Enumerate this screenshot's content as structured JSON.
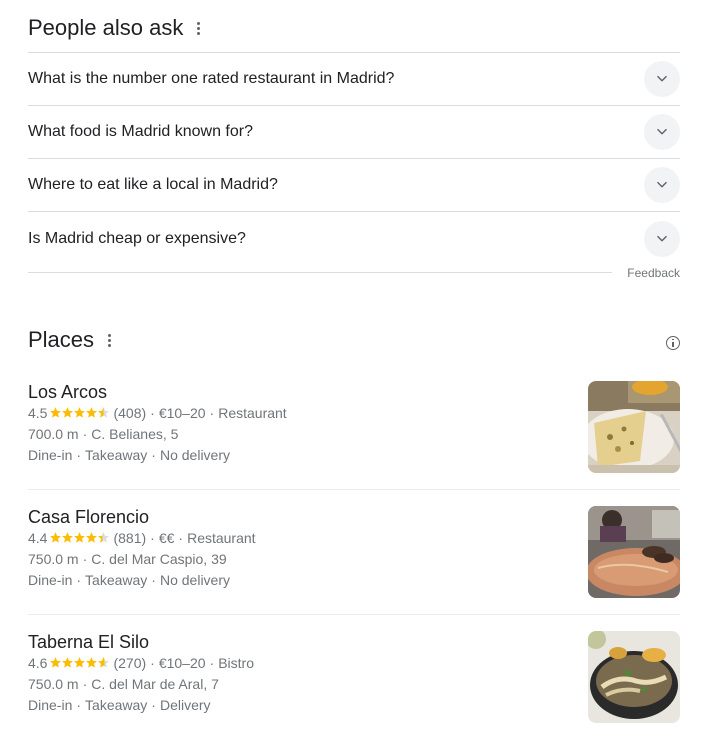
{
  "paa": {
    "title": "People also ask",
    "questions": [
      "What is the number one rated restaurant in Madrid?",
      "What food is Madrid known for?",
      "Where to eat like a local in Madrid?",
      "Is Madrid cheap or expensive?"
    ],
    "feedback": "Feedback"
  },
  "places": {
    "title": "Places",
    "items": [
      {
        "name": "Los Arcos",
        "rating": "4.5",
        "rating_value": 4.5,
        "reviews": "(408)",
        "price": "€10–20",
        "category": "Restaurant",
        "distance": "700.0 m",
        "address": "C. Belianes, 5",
        "services": [
          "Dine-in",
          "Takeaway",
          "No delivery"
        ]
      },
      {
        "name": "Casa Florencio",
        "rating": "4.4",
        "rating_value": 4.4,
        "reviews": "(881)",
        "price": "€€",
        "category": "Restaurant",
        "distance": "750.0 m",
        "address": "C. del Mar Caspio, 39",
        "services": [
          "Dine-in",
          "Takeaway",
          "No delivery"
        ]
      },
      {
        "name": "Taberna El Silo",
        "rating": "4.6",
        "rating_value": 4.6,
        "reviews": "(270)",
        "price": "€10–20",
        "category": "Bistro",
        "distance": "750.0 m",
        "address": "C. del Mar de Aral, 7",
        "services": [
          "Dine-in",
          "Takeaway",
          "Delivery"
        ]
      }
    ]
  },
  "colors": {
    "star": "#fbbc04",
    "star_empty": "#dadce0",
    "muted_text": "#70757a"
  }
}
